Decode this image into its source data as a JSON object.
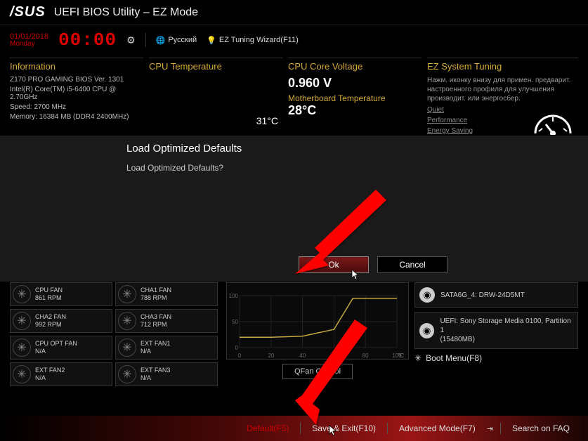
{
  "header": {
    "brand": "/SUS",
    "title": "UEFI BIOS Utility – EZ Mode"
  },
  "topbar": {
    "date": "01/01/2018",
    "day": "Monday",
    "time": "00:00",
    "lang": "Русский",
    "wizard": "EZ Tuning Wizard(F11)"
  },
  "info": {
    "title": "Information",
    "board": "Z170 PRO GAMING   BIOS Ver. 1301",
    "cpu": "Intel(R) Core(TM) i5-6400 CPU @ 2.70GHz",
    "speed": "Speed: 2700 MHz",
    "memory": "Memory: 16384 MB (DDR4 2400MHz)"
  },
  "cpu_temp": {
    "title": "CPU Temperature",
    "value": "31°C"
  },
  "cpu_volt": {
    "title": "CPU Core Voltage",
    "value": "0.960 V",
    "mb_label": "Motherboard Temperature",
    "mb_value": "28°C"
  },
  "ez": {
    "title": "EZ System Tuning",
    "desc": "Нажм. иконку внизу для примен. предварит. настроенного профиля для улучшения производит. или энергосбер.",
    "opts": [
      "Quiet",
      "Performance",
      "Energy Saving"
    ]
  },
  "dialog": {
    "title": "Load Optimized Defaults",
    "question": "Load Optimized Defaults?",
    "ok": "Ok",
    "cancel": "Cancel"
  },
  "fans": [
    {
      "name": "CPU FAN",
      "rpm": "861 RPM"
    },
    {
      "name": "CHA1 FAN",
      "rpm": "788 RPM"
    },
    {
      "name": "CHA2 FAN",
      "rpm": "992 RPM"
    },
    {
      "name": "CHA3 FAN",
      "rpm": "712 RPM"
    },
    {
      "name": "CPU OPT FAN",
      "rpm": "N/A"
    },
    {
      "name": "EXT FAN1",
      "rpm": "N/A"
    },
    {
      "name": "EXT FAN2",
      "rpm": "N/A"
    },
    {
      "name": "EXT FAN3",
      "rpm": "N/A"
    }
  ],
  "qfan": "QFan Control",
  "drives": [
    {
      "label": "SATA6G_4: DRW-24D5MT",
      "sub": ""
    },
    {
      "label": "UEFI: Sony Storage Media 0100, Partition 1",
      "sub": "(15480MB)"
    }
  ],
  "boot_menu": "Boot Menu(F8)",
  "footer": {
    "default": "Default(F5)",
    "save": "Save & Exit(F10)",
    "adv": "Advanced Mode(F7)",
    "search": "Search on FAQ"
  },
  "chart_data": {
    "type": "line",
    "title": "",
    "xlabel": "°C",
    "ylabel": "",
    "x": [
      0,
      20,
      40,
      60,
      72,
      100
    ],
    "values": [
      20,
      20,
      22,
      35,
      95,
      95
    ],
    "ylim": [
      0,
      100
    ],
    "xlim": [
      0,
      100
    ]
  }
}
